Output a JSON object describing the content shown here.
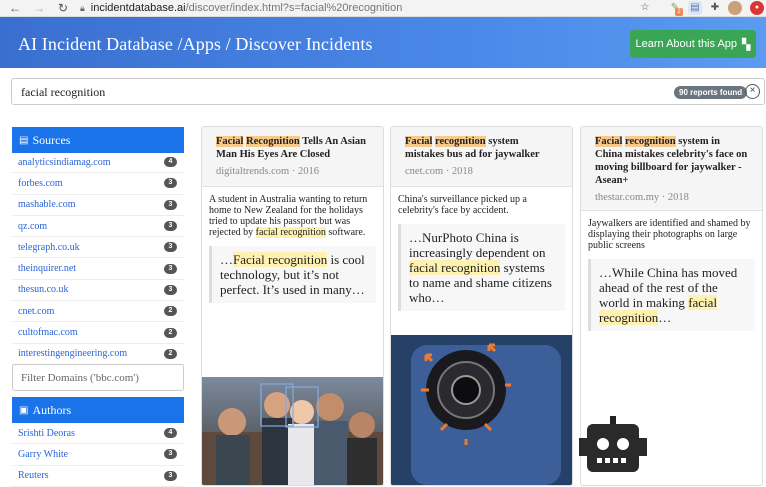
{
  "browser": {
    "url_host": "incidentdatabase.ai",
    "url_path": "/discover/index.html?s=facial%20recognition",
    "ext_badge": "2"
  },
  "header": {
    "title": "AI Incident Database /Apps / Discover Incidents",
    "learn_label": "Learn About this App"
  },
  "search": {
    "query": "facial recognition",
    "reports_found": "90 reports found"
  },
  "sources": {
    "heading": "Sources",
    "items": [
      {
        "label": "analyticsindiamag.com",
        "count": "4"
      },
      {
        "label": "forbes.com",
        "count": "3"
      },
      {
        "label": "mashable.com",
        "count": "3"
      },
      {
        "label": "qz.com",
        "count": "3"
      },
      {
        "label": "telegraph.co.uk",
        "count": "3"
      },
      {
        "label": "theinquirer.net",
        "count": "3"
      },
      {
        "label": "thesun.co.uk",
        "count": "3"
      },
      {
        "label": "cnet.com",
        "count": "2"
      },
      {
        "label": "cultofmac.com",
        "count": "2"
      },
      {
        "label": "interestingengineering.com",
        "count": "2"
      }
    ],
    "filter_placeholder": "Filter Domains ('bbc.com')"
  },
  "authors": {
    "heading": "Authors",
    "items": [
      {
        "label": "Srishti Deoras",
        "count": "4"
      },
      {
        "label": "Garry White",
        "count": "3"
      },
      {
        "label": "Reuters",
        "count": "3"
      }
    ]
  },
  "cards": [
    {
      "title_hl1": "Facial",
      "title_hl2": "Recognition",
      "title_rest": " Tells An Asian Man His Eyes Are Closed",
      "source": "digitaltrends.com · 2016",
      "body_pre": "A student in Australia wanting to return home to New Zealand for the holidays tried to update his passport but was rejected by ",
      "body_hl": "facial recognition",
      "body_post": " software.",
      "quote_pre": "…",
      "quote_hl": "Facial recognition",
      "quote_post": " is cool technology, but it’s not perfect. It’s used in many…"
    },
    {
      "title_hl1": "Facial",
      "title_hl2": "recognition",
      "title_rest": " system mistakes bus ad for jaywalker",
      "source": "cnet.com · 2018",
      "body_pre": "China's surveillance picked up a celebrity's face by accident.",
      "quote_pre": "…NurPhoto China is increasingly dependent on ",
      "quote_hl": "facial recognition",
      "quote_post": " systems to name and shame citizens who…"
    },
    {
      "title_hl1": "Facial",
      "title_hl2": "recognition",
      "title_rest": " system in China mistakes celebrity's face on moving billboard for jaywalker - Asean+",
      "source": "thestar.com.my · 2018",
      "body_pre": "Jaywalkers are identified and shamed by displaying their photographs on large public screens",
      "quote_pre": "…While China has moved ahead of the rest of the world in making ",
      "quote_hl": "facial recognition",
      "quote_post": "…"
    }
  ],
  "colors": {
    "header_blue": "#3a6fcf",
    "panel_blue": "#1a73e8",
    "learn_green": "#3aa655",
    "highlight_orange": "#f7c98a",
    "highlight_yellow": "#fff2b0"
  }
}
